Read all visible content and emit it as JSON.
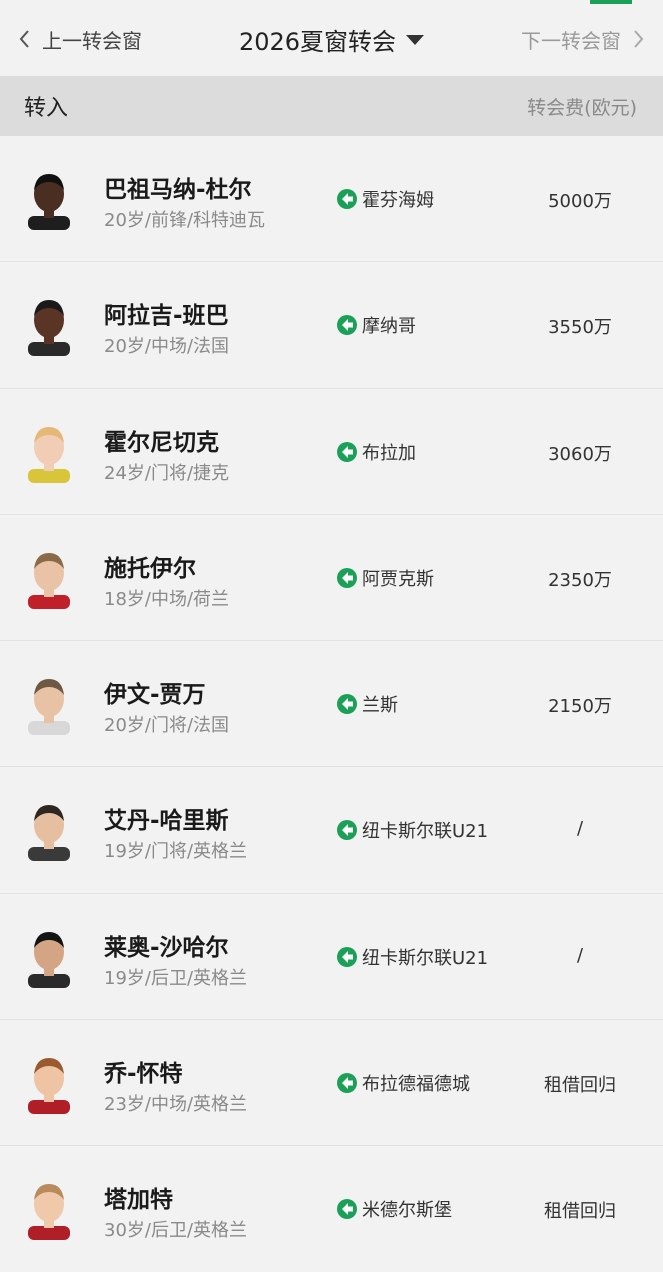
{
  "nav": {
    "prev_label": "上一转会窗",
    "title": "2026夏窗转会",
    "next_label": "下一转会窗"
  },
  "section": {
    "title": "转入",
    "fee_header": "转会费(欧元)"
  },
  "colors": {
    "accent": "#1aa157",
    "header_bg": "#dcdcdc",
    "page_bg": "#f2f2f2"
  },
  "players": [
    {
      "name": "巴祖马纳-杜尔",
      "info": "20岁/前锋/科特迪瓦",
      "club": "霍芬海姆",
      "fee": "5000万",
      "skin": "#4a2e22",
      "hair": "#111111",
      "shirt": "#1e1e1e"
    },
    {
      "name": "阿拉吉-班巴",
      "info": "20岁/中场/法国",
      "club": "摩纳哥",
      "fee": "3550万",
      "skin": "#5a3526",
      "hair": "#1a1a1a",
      "shirt": "#2a2a2a"
    },
    {
      "name": "霍尔尼切克",
      "info": "24岁/门将/捷克",
      "club": "布拉加",
      "fee": "3060万",
      "skin": "#f0cdb4",
      "hair": "#e6b878",
      "shirt": "#d9c53a"
    },
    {
      "name": "施托伊尔",
      "info": "18岁/中场/荷兰",
      "club": "阿贾克斯",
      "fee": "2350万",
      "skin": "#eac3a6",
      "hair": "#8a6a48",
      "shirt": "#c0202a"
    },
    {
      "name": "伊文-贾万",
      "info": "20岁/门将/法国",
      "club": "兰斯",
      "fee": "2150万",
      "skin": "#e8c2a4",
      "hair": "#6e5a44",
      "shirt": "#d8d8d8"
    },
    {
      "name": "艾丹-哈里斯",
      "info": "19岁/门将/英格兰",
      "club": "纽卡斯尔联U21",
      "fee": "/",
      "skin": "#e6bea0",
      "hair": "#2e2620",
      "shirt": "#3a3a3a"
    },
    {
      "name": "莱奥-沙哈尔",
      "info": "19岁/后卫/英格兰",
      "club": "纽卡斯尔联U21",
      "fee": "/",
      "skin": "#d4a584",
      "hair": "#141414",
      "shirt": "#2a2a2a"
    },
    {
      "name": "乔-怀特",
      "info": "23岁/中场/英格兰",
      "club": "布拉德福德城",
      "fee": "租借回归",
      "skin": "#eec4a4",
      "hair": "#9a5a30",
      "shirt": "#b01e28"
    },
    {
      "name": "塔加特",
      "info": "30岁/后卫/英格兰",
      "club": "米德尔斯堡",
      "fee": "租借回归",
      "skin": "#f0c8aa",
      "hair": "#b88a5c",
      "shirt": "#b01e28"
    }
  ]
}
